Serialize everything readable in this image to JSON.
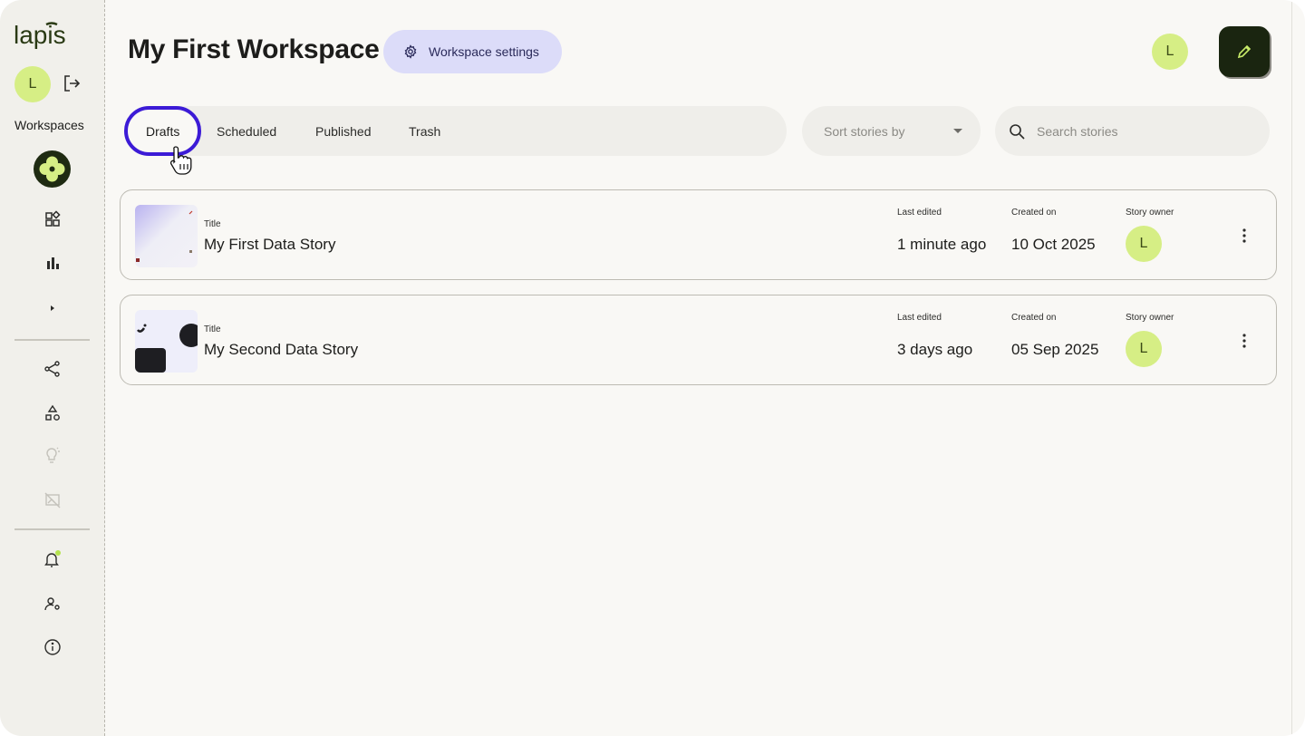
{
  "app": {
    "logo_text": "lapis"
  },
  "sidebar": {
    "avatar_initial": "L",
    "workspaces_label": "Workspaces",
    "nav_icons": [
      "grid-icon",
      "bar-chart-icon",
      "expand-caret-icon",
      "share-icon",
      "shapes-icon",
      "lightbulb-icon",
      "image-off-icon",
      "bell-icon",
      "user-settings-icon",
      "info-icon"
    ]
  },
  "header": {
    "title": "My First Workspace",
    "settings_label": "Workspace settings",
    "avatar_initial": "L"
  },
  "tabs": [
    {
      "label": "Drafts",
      "active": true
    },
    {
      "label": "Scheduled",
      "active": false
    },
    {
      "label": "Published",
      "active": false
    },
    {
      "label": "Trash",
      "active": false
    }
  ],
  "sort": {
    "placeholder": "Sort stories by"
  },
  "search": {
    "placeholder": "Search stories"
  },
  "stories": {
    "title_label": "Title",
    "last_edited_label": "Last edited",
    "created_label": "Created on",
    "owner_label": "Story owner",
    "items": [
      {
        "title": "My First Data Story",
        "last_edited": "1 minute ago",
        "created": "10 Oct 2025",
        "owner_initial": "L"
      },
      {
        "title": "My Second Data Story",
        "last_edited": "3 days ago",
        "created": "05 Sep 2025",
        "owner_initial": "L"
      }
    ]
  },
  "colors": {
    "accent_green": "#d6ee85",
    "dark_green": "#1a2510",
    "focus_ring": "#3c1bd6",
    "settings_bg": "#dcdcf9"
  }
}
